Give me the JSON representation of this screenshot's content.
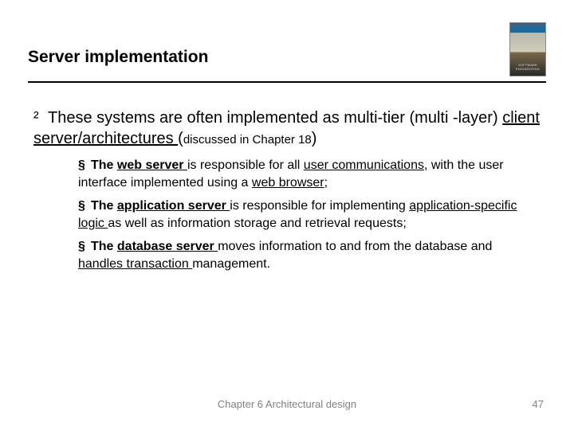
{
  "heading": "Server implementation",
  "cover_label": "SOFTWARE ENGINEERING",
  "intro": {
    "bullet": "²",
    "text_1": "These systems are often implemented as multi-tier (multi -layer) ",
    "underlined": "client server/architectures ",
    "paren_open": "(",
    "small_text": "discussed in Chapter 18",
    "paren_close": ")"
  },
  "points": [
    {
      "bullet": "§",
      "pre": "The ",
      "u1": "web server ",
      "mid1": "is responsible for all ",
      "u2": "user communications",
      "mid2": ", with the user interface implemented using a ",
      "u3": "web browser",
      "post": ";"
    },
    {
      "bullet": "§",
      "pre": "The ",
      "u1": "application server ",
      "mid1": "is responsible for implementing ",
      "u2": "application-specific logic ",
      "mid2": "as well as information storage and retrieval requests;",
      "u3": "",
      "post": ""
    },
    {
      "bullet": "§",
      "pre": "The ",
      "u1": "database server ",
      "mid1": "moves information to and from the database and ",
      "u2": "handles transaction ",
      "mid2": "management.",
      "u3": "",
      "post": ""
    }
  ],
  "footer_center": "Chapter 6 Architectural design",
  "footer_right": "47"
}
